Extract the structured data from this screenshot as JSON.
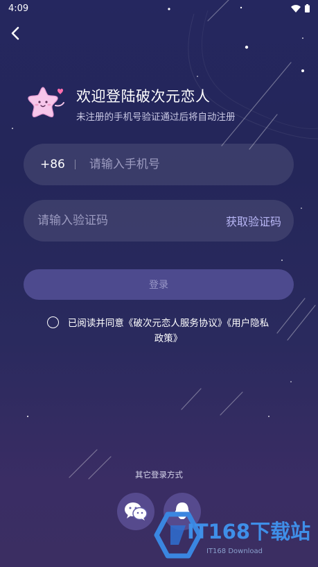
{
  "status_bar": {
    "time": "4:09"
  },
  "header": {
    "title": "欢迎登陆破次元恋人",
    "subtitle": "未注册的手机号验证通过后将自动注册"
  },
  "phone": {
    "country_code": "+86",
    "placeholder": "请输入手机号",
    "value": ""
  },
  "code": {
    "placeholder": "请输入验证码",
    "value": "",
    "get_code_label": "获取验证码"
  },
  "login_button": {
    "label": "登录"
  },
  "agreement": {
    "prefix": "已阅读并同意",
    "service_link": "《破次元恋人服务协议》",
    "privacy_link": "《用户隐私政策》",
    "checked": false
  },
  "other_login": {
    "title": "其它登录方式",
    "options": [
      "wechat-icon",
      "qq-icon"
    ]
  },
  "watermark": {
    "brand": "IT168下载站",
    "sub": "IT168 Download"
  },
  "colors": {
    "accent": "#b8b6f5",
    "button_bg": "#4d4a8e",
    "watermark": "#3f8fe8"
  }
}
